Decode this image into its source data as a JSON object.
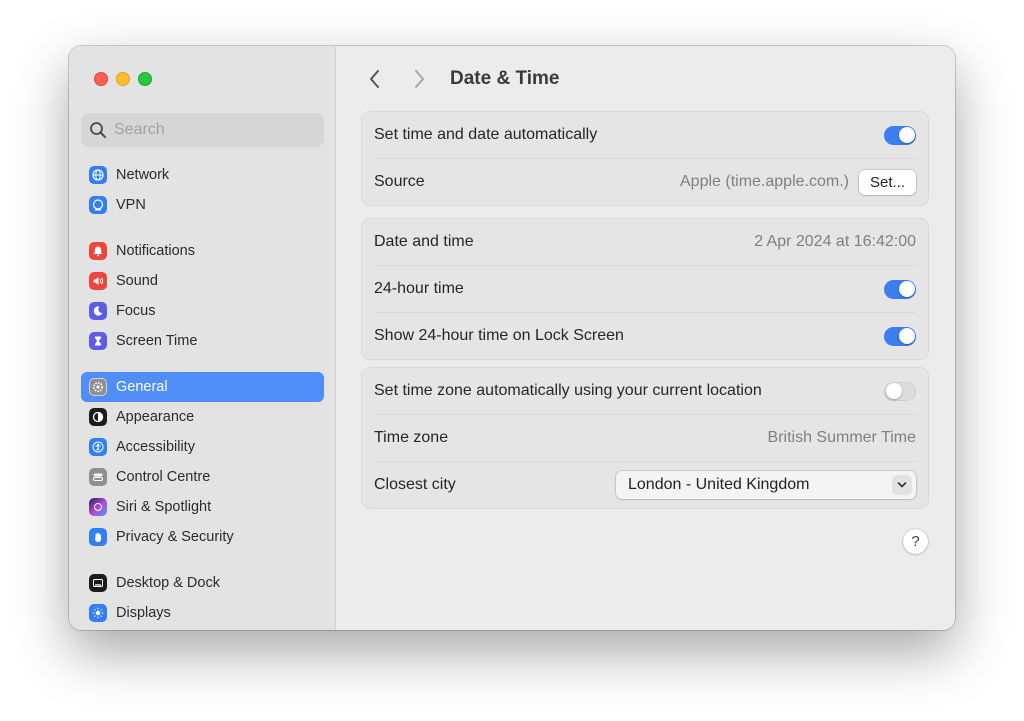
{
  "window": {
    "title": "Date & Time",
    "back_icon": "chevron-left-icon",
    "forward_icon": "chevron-right-icon"
  },
  "search": {
    "placeholder": "Search",
    "icon": "magnifier-icon"
  },
  "sidebar": {
    "items": [
      {
        "label": "Network",
        "icon": "network-globe-icon",
        "color": "#2f7ff5"
      },
      {
        "label": "VPN",
        "icon": "vpn-globe-icon",
        "color": "#2f7ff5"
      },
      {
        "label": "Notifications",
        "icon": "bell-icon",
        "color": "#f0453f"
      },
      {
        "label": "Sound",
        "icon": "speaker-icon",
        "color": "#f0453f"
      },
      {
        "label": "Focus",
        "icon": "moon-icon",
        "color": "#5e5ce6"
      },
      {
        "label": "Screen Time",
        "icon": "hourglass-icon",
        "color": "#5e5ce6"
      },
      {
        "label": "General",
        "icon": "gear-icon",
        "color": "#8e8e93",
        "active": true
      },
      {
        "label": "Appearance",
        "icon": "appearance-icon",
        "color": "#1c1c1e"
      },
      {
        "label": "Accessibility",
        "icon": "accessibility-icon",
        "color": "#2f7ff5"
      },
      {
        "label": "Control Centre",
        "icon": "control-centre-icon",
        "color": "#8e8e93"
      },
      {
        "label": "Siri & Spotlight",
        "icon": "siri-icon",
        "color": "#b74bd9"
      },
      {
        "label": "Privacy & Security",
        "icon": "hand-icon",
        "color": "#2f7ff5"
      },
      {
        "label": "Desktop & Dock",
        "icon": "dock-icon",
        "color": "#1c1c1e"
      },
      {
        "label": "Displays",
        "icon": "sun-icon",
        "color": "#2f7ff5"
      }
    ]
  },
  "groups": {
    "auto_time": {
      "set_auto_label": "Set time and date automatically",
      "set_auto_on": true,
      "source_label": "Source",
      "source_value": "Apple (time.apple.com.)",
      "set_button": "Set..."
    },
    "format": {
      "date_time_label": "Date and time",
      "date_time_value": "2 Apr 2024 at 16:42:00",
      "hour24_label": "24-hour time",
      "hour24_on": true,
      "lock_label": "Show 24-hour time on Lock Screen",
      "lock_on": true
    },
    "timezone": {
      "auto_tz_label": "Set time zone automatically using your current location",
      "auto_tz_on": false,
      "tz_label": "Time zone",
      "tz_value": "British Summer Time",
      "city_label": "Closest city",
      "city_value": "London - United Kingdom"
    }
  },
  "help_label": "?",
  "colors": {
    "accent": "#3a7ef0",
    "selection": "#4f8ef7"
  }
}
